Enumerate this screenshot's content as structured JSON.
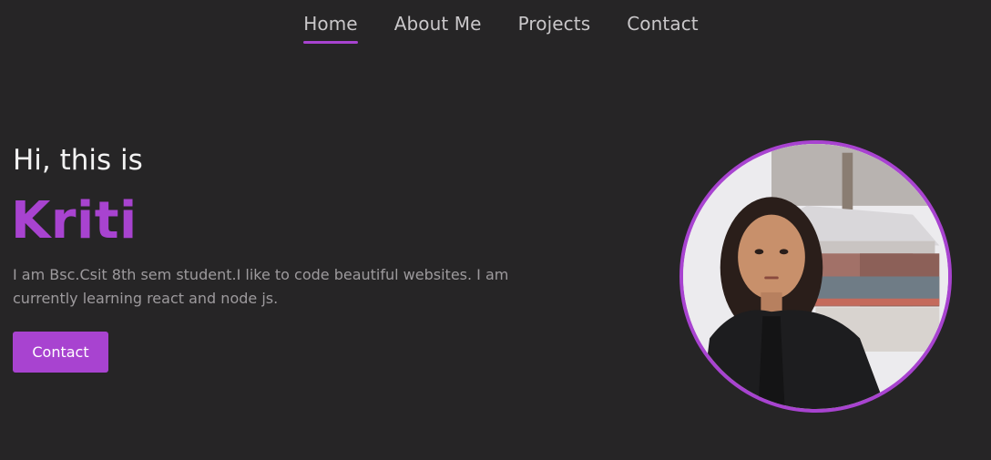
{
  "nav": {
    "items": [
      {
        "label": "Home",
        "active": true
      },
      {
        "label": "About Me",
        "active": false
      },
      {
        "label": "Projects",
        "active": false
      },
      {
        "label": "Contact",
        "active": false
      }
    ]
  },
  "hero": {
    "greeting": "Hi, this is",
    "name": "Kriti",
    "bio": "I am Bsc.Csit 8th sem student.I like to code beautiful websites. I am currently learning react and node js.",
    "contact_button": "Contact"
  },
  "colors": {
    "background": "#262526",
    "accent": "#a843d0",
    "nav_text": "#c9c7c9",
    "bio_text": "#9d9a9d"
  },
  "icons": {
    "portrait": "profile-photo"
  }
}
